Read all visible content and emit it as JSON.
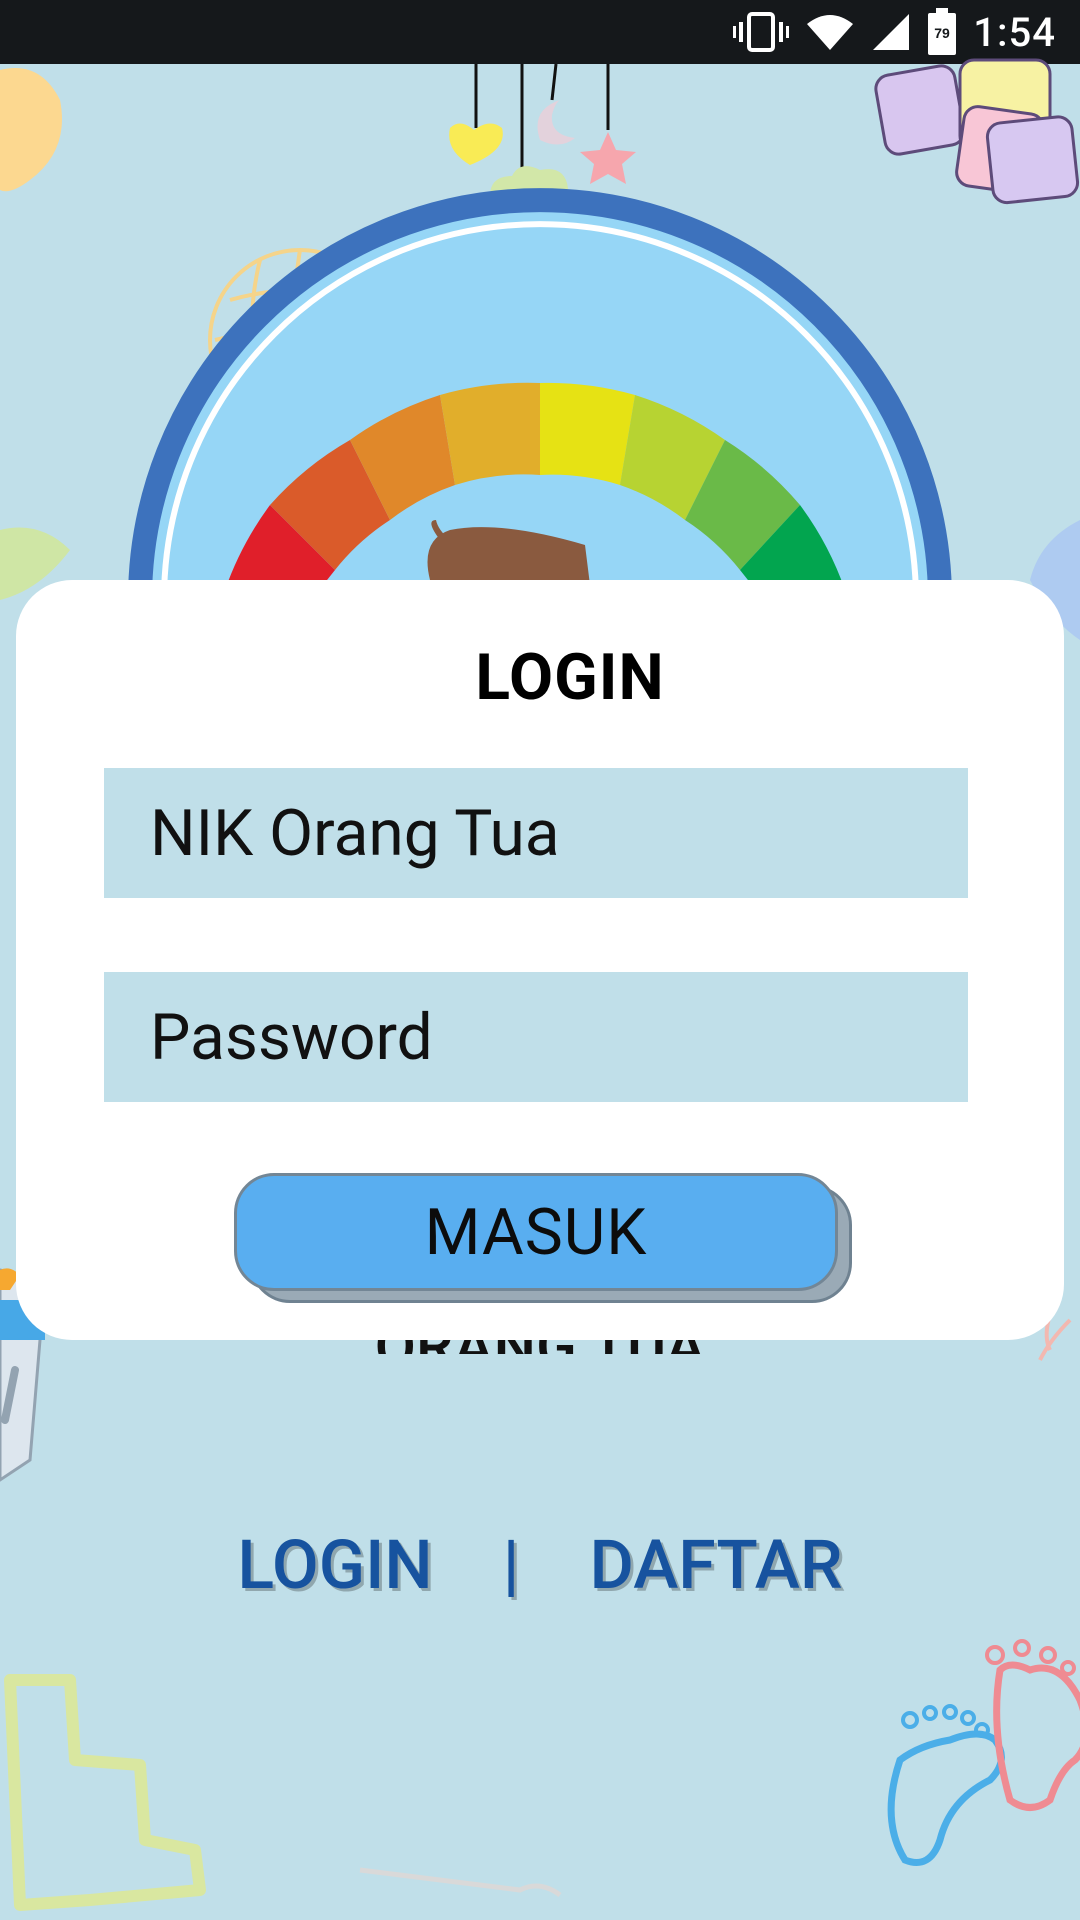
{
  "status_bar": {
    "time": "1:54",
    "battery_level": "79",
    "icons": [
      "vibrate-icon",
      "wifi-icon",
      "signal-icon",
      "battery-icon"
    ]
  },
  "card": {
    "title": "LOGIN",
    "nik_placeholder": "NIK Orang Tua",
    "password_placeholder": "Password",
    "submit_label": "MASUK"
  },
  "partially_hidden_text": "ORANG TUA",
  "bottom_nav": {
    "login_label": "LOGIN",
    "separator": "|",
    "register_label": "DAFTAR"
  },
  "colors": {
    "background": "#c0dfe9",
    "status_bar": "#15181b",
    "button": "#59aef0",
    "link": "#17539f"
  }
}
